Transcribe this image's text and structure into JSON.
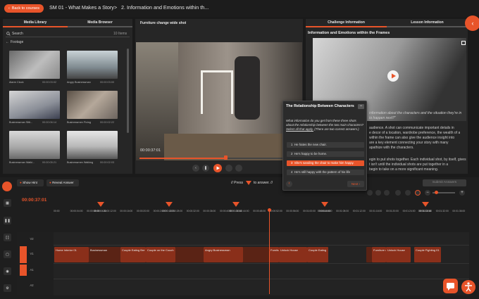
{
  "topbar": {
    "back_label": "Back to courses",
    "title": "SM 01 - What Makes a Story",
    "separator": ">",
    "subtitle": "2. Information and Emotions within th..."
  },
  "media": {
    "tabs": [
      "Media Library",
      "Media Browser"
    ],
    "search_placeholder": "Search",
    "count": "10 Items",
    "folder": "Footage",
    "items": [
      {
        "name": "Alarm Clock",
        "duration": "00:00:03:02"
      },
      {
        "name": "Angry Businessman",
        "duration": "00:00:03:00"
      },
      {
        "name": "Businessman Sitti...",
        "duration": "00:00:06:14"
      },
      {
        "name": "Businessmen Fixing",
        "duration": "00:00:02:22"
      },
      {
        "name": "Businessman Walki...",
        "duration": "00:00:05:21"
      },
      {
        "name": "Businessmen Walking",
        "duration": "00:00:02:03"
      }
    ]
  },
  "viewer": {
    "title": "Furniture change wide shot",
    "timecode": "00:00:37:01"
  },
  "challenge": {
    "tabs": [
      "Challenge Information",
      "Lesson Information"
    ],
    "heading": "Information and Emotions within the Frames",
    "body_lines": [
      "information about the characters and the situation they're in",
      "to happen next?\"",
      "audience. A shot can communicate important details in",
      "e decor of a location, wardrobe preference, the wealth of a",
      "within the frame can also give the audience insight into",
      "are a key element connecting your story with many",
      "apathize with the characters.",
      "egin to put shots together. Each individual shot, by itself, gives",
      "t isn't until the individual shots are put together in a",
      "begin to take on a more significant meaning."
    ]
  },
  "quiz": {
    "title": "The Relationship Between Characters",
    "minimize": "−",
    "question_a": "What information do you get from these three shots about the relationship between the two main characters?",
    "question_b": "Select all that apply.",
    "question_c": "(There are two correct answers.)",
    "options": [
      {
        "letter": "1",
        "text": "He hates the new chair."
      },
      {
        "letter": "2",
        "text": "He's happy to be home."
      },
      {
        "letter": "3",
        "text": "She's sanding the chair to make him happy."
      },
      {
        "letter": "4",
        "text": "He's still happy with the pattern of his life"
      }
    ],
    "next_label": "Next"
  },
  "timeline_bar": {
    "show_hint": "Show Hint",
    "reveal": "Reveal Answer",
    "press_prefix": "// Press",
    "press_suffix": "to answer. //",
    "submit": "Submit Answers",
    "timecode": "00:00:37:01",
    "ruler": [
      "00:00",
      "00:00:04:00",
      "00:00:08:00",
      "00:00:12:00",
      "00:00:16:00",
      "00:00:20:00",
      "00:00:24:00",
      "00:00:28:00",
      "00:00:32:00",
      "00:00:36:00",
      "00:00:40:00",
      "00:00:44:00",
      "00:00:48:00",
      "00:00:52:00",
      "00:00:56:00",
      "00:01:00:00",
      "00:01:04:00",
      "00:01:08:00",
      "00:01:12:00",
      "00:01:16:00",
      "00:01:20:00",
      "00:01:24:00",
      "00:01:28:00",
      "00:01:32:00",
      "00:01:36:00"
    ],
    "markers": [
      "00:00:04:24",
      "00:00:12:21",
      "00:00:24:14",
      "00:00:37:11",
      "00:00:44:08",
      "00:00:59:01",
      "00:01:31:16"
    ],
    "tracks": [
      "V2",
      "V1",
      "A1",
      "A2"
    ],
    "clips": [
      {
        "label": "Home Interior 01"
      },
      {
        "label": "Businessman"
      },
      {
        "label": "Couple Eating Bre"
      },
      {
        "label": "Couple on the Couch"
      },
      {
        "label": "Angry Businessman"
      },
      {
        "label": "Bu"
      },
      {
        "label": "Furniture chan"
      },
      {
        "label": "Unlock House"
      },
      {
        "label": "Couple Eating"
      },
      {
        "label": "Furniture c"
      },
      {
        "label": "Unlock House"
      },
      {
        "label": "Couple Fighting 01"
      }
    ]
  },
  "colors": {
    "accent": "#e8542a",
    "bg": "#1a1a1a",
    "panel": "#262626"
  }
}
